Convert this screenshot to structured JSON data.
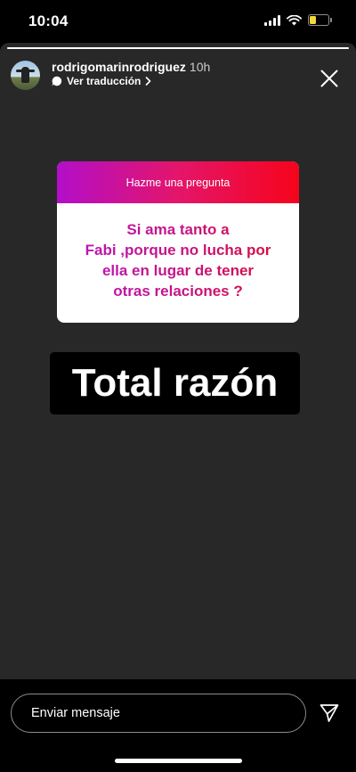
{
  "status_bar": {
    "time": "10:04",
    "battery_level": 0.3,
    "battery_color": "#f3d83a"
  },
  "story": {
    "background": "#282828",
    "progress": 1.0,
    "header": {
      "username": "rodrigomarinrodriguez",
      "time_ago": "10h",
      "translate_label": "Ver traducción"
    },
    "question_sticker": {
      "title": "Hazme una pregunta",
      "question": "Si ama tanto a\nFabi ,porque no lucha por\nella en lugar de tener\notras relaciones ?",
      "gradient_colors": [
        "#b30ec9",
        "#e4156a",
        "#f6041b"
      ]
    },
    "caption": "Total razón"
  },
  "reply": {
    "placeholder": "Enviar mensaje"
  },
  "icons": [
    "signal-icon",
    "wifi-icon",
    "battery-icon",
    "speech-bubble-icon",
    "chevron-right-icon",
    "close-icon",
    "send-icon"
  ]
}
